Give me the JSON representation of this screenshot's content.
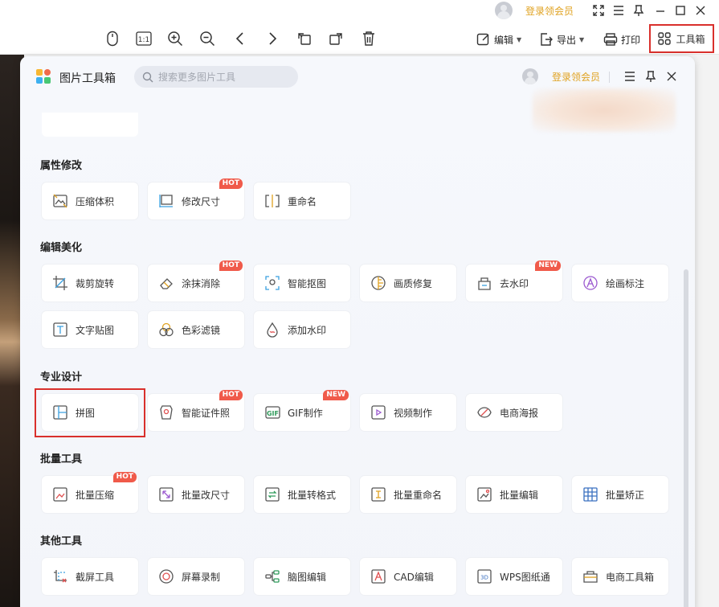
{
  "titlebar": {
    "vip_label": "登录领会员"
  },
  "toolbar": {
    "edit_label": "编辑",
    "export_label": "导出",
    "print_label": "打印",
    "toolbox_label": "工具箱"
  },
  "panel": {
    "title": "图片工具箱",
    "search_placeholder": "搜索更多图片工具",
    "vip_label": "登录领会员"
  },
  "sections": [
    {
      "title": "属性修改",
      "items": [
        {
          "label": "压缩体积",
          "icon": "compress-icon"
        },
        {
          "label": "修改尺寸",
          "icon": "resize-icon",
          "badge": "HOT"
        },
        {
          "label": "重命名",
          "icon": "rename-icon"
        }
      ]
    },
    {
      "title": "编辑美化",
      "items": [
        {
          "label": "裁剪旋转",
          "icon": "crop-icon"
        },
        {
          "label": "涂抹消除",
          "icon": "eraser-icon",
          "badge": "HOT"
        },
        {
          "label": "智能抠图",
          "icon": "cutout-icon"
        },
        {
          "label": "画质修复",
          "icon": "quality-icon"
        },
        {
          "label": "去水印",
          "icon": "remove-watermark-icon",
          "badge": "NEW"
        },
        {
          "label": "绘画标注",
          "icon": "draw-icon"
        },
        {
          "label": "文字贴图",
          "icon": "text-icon"
        },
        {
          "label": "色彩滤镜",
          "icon": "filter-icon"
        },
        {
          "label": "添加水印",
          "icon": "add-watermark-icon"
        }
      ]
    },
    {
      "title": "专业设计",
      "items": [
        {
          "label": "拼图",
          "icon": "collage-icon"
        },
        {
          "label": "智能证件照",
          "icon": "id-photo-icon",
          "badge": "HOT"
        },
        {
          "label": "GIF制作",
          "icon": "gif-icon",
          "badge": "NEW"
        },
        {
          "label": "视频制作",
          "icon": "video-icon"
        },
        {
          "label": "电商海报",
          "icon": "poster-icon"
        }
      ]
    },
    {
      "title": "批量工具",
      "items": [
        {
          "label": "批量压缩",
          "icon": "batch-compress-icon",
          "badge": "HOT"
        },
        {
          "label": "批量改尺寸",
          "icon": "batch-resize-icon"
        },
        {
          "label": "批量转格式",
          "icon": "batch-convert-icon"
        },
        {
          "label": "批量重命名",
          "icon": "batch-rename-icon"
        },
        {
          "label": "批量编辑",
          "icon": "batch-edit-icon"
        },
        {
          "label": "批量矫正",
          "icon": "batch-correct-icon"
        }
      ]
    },
    {
      "title": "其他工具",
      "items": [
        {
          "label": "截屏工具",
          "icon": "screenshot-icon"
        },
        {
          "label": "屏幕录制",
          "icon": "record-icon"
        },
        {
          "label": "脑图编辑",
          "icon": "mindmap-icon"
        },
        {
          "label": "CAD编辑",
          "icon": "cad-icon"
        },
        {
          "label": "WPS图纸通",
          "icon": "wps-drawing-icon"
        },
        {
          "label": "电商工具箱",
          "icon": "ecommerce-toolbox-icon"
        }
      ]
    }
  ]
}
